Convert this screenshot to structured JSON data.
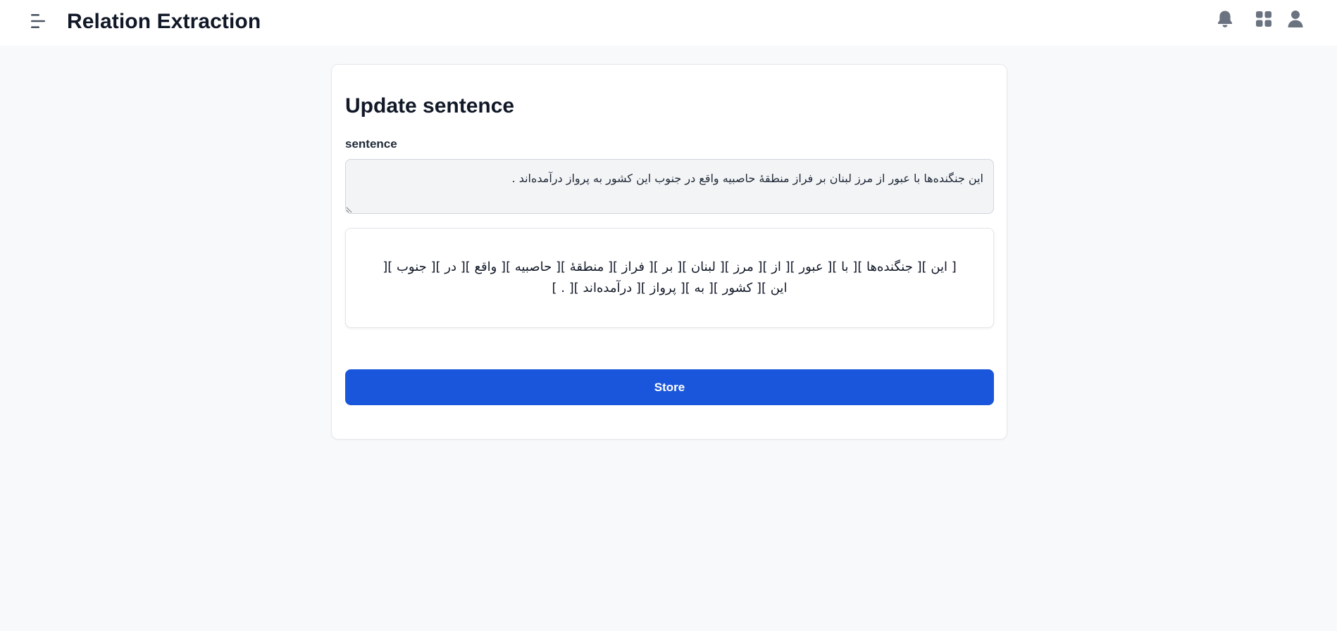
{
  "app": {
    "title": "Relation Extraction"
  },
  "header": {
    "icons": [
      "menu-icon",
      "bell-icon",
      "apps-grid-icon",
      "user-icon"
    ]
  },
  "form": {
    "title": "Update sentence",
    "sentence_label": "sentence",
    "sentence_value": "این جنگنده‌ها با عبور از مرز لبنان بر فراز منطقهٔ حاصبیه واقع در جنوب این کشور به پرواز درآمده‌اند .",
    "tokens_display": "[ این ][ جنگنده‌ها ][ با ][ عبور ][ از ][ مرز ][ لبنان ][ بر ][ فراز ][ منطقهٔ ][ حاصبیه ][ واقع ][ در ][ جنوب ][ این ][ کشور ][ به ][ پرواز ][ درآمده‌اند ][ . ]",
    "store_label": "Store"
  },
  "colors": {
    "primary": "#1a56db",
    "background": "#f8f9fb",
    "icon": "#6b7280"
  }
}
